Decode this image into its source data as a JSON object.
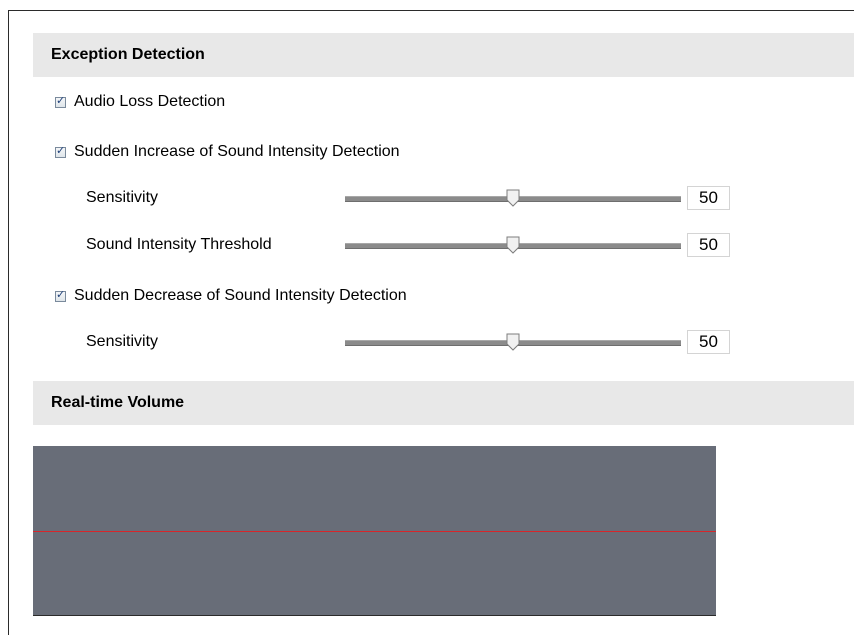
{
  "exception_detection": {
    "title": "Exception Detection",
    "audio_loss": {
      "label": "Audio Loss Detection",
      "checked": true
    },
    "sudden_increase": {
      "label": "Sudden Increase of Sound Intensity Detection",
      "checked": true,
      "sensitivity": {
        "label": "Sensitivity",
        "value": "50",
        "fraction": 0.5
      },
      "threshold": {
        "label": "Sound Intensity Threshold",
        "value": "50",
        "fraction": 0.5
      }
    },
    "sudden_decrease": {
      "label": "Sudden Decrease of Sound Intensity Detection",
      "checked": true,
      "sensitivity": {
        "label": "Sensitivity",
        "value": "50",
        "fraction": 0.5
      }
    }
  },
  "realtime_volume": {
    "title": "Real-time Volume",
    "threshold_fraction": 0.5,
    "panel_color": "#686d78",
    "line_color": "#d7262b"
  }
}
